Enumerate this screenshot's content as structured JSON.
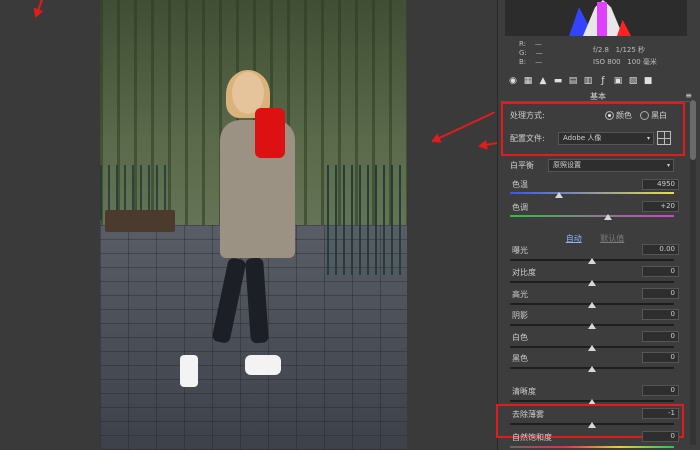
{
  "histogram_info": {
    "r_label": "R:",
    "g_label": "G:",
    "b_label": "B:",
    "r_value": "—",
    "g_value": "—",
    "b_value": "—",
    "aperture": "f/2.8",
    "shutter": "1/125 秒",
    "iso": "ISO 800",
    "focal": "100 毫米"
  },
  "panel": {
    "section_title": "基本"
  },
  "treatment": {
    "label": "处理方式:",
    "option_color": "颜色",
    "option_bw": "黑白",
    "selected": "颜色"
  },
  "profile": {
    "label": "配置文件:",
    "value": "Adobe 人像"
  },
  "white_balance": {
    "label": "白平衡",
    "value": "原照设置"
  },
  "sliders": {
    "temp": {
      "label": "色温",
      "value": "4950"
    },
    "tint": {
      "label": "色调",
      "value": "+20"
    },
    "exposure": {
      "label": "曝光",
      "value": "0.00"
    },
    "contrast": {
      "label": "对比度",
      "value": "0"
    },
    "highlights": {
      "label": "高光",
      "value": "0"
    },
    "shadows": {
      "label": "阴影",
      "value": "0"
    },
    "whites": {
      "label": "白色",
      "value": "0"
    },
    "blacks": {
      "label": "黑色",
      "value": "0"
    },
    "clarity": {
      "label": "清晰度",
      "value": "0"
    },
    "dehaze": {
      "label": "去除薄雾",
      "value": "-1"
    },
    "vibrance": {
      "label": "自然饱和度",
      "value": "0"
    }
  },
  "auto_buttons": {
    "auto": "自动",
    "default": "默认值"
  },
  "colors": {
    "accent_red": "#e31b1b",
    "panel_bg": "#3d3d3d"
  }
}
